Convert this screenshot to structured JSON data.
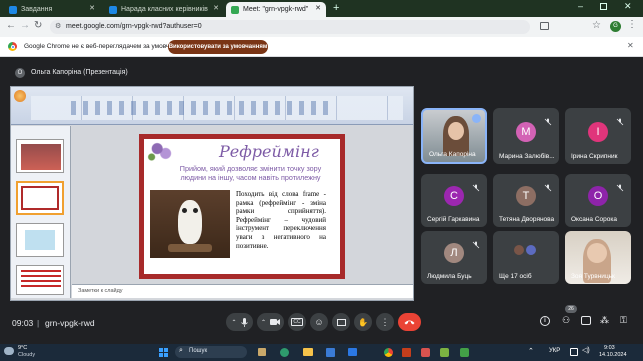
{
  "tabs": [
    {
      "label": "Завдання",
      "color": "#1e88e5"
    },
    {
      "label": "Нарада класних керівників",
      "color": "#1e88e5"
    },
    {
      "label": "Meet: \"grn-vpgk-rwd\"",
      "color": "#34a853"
    }
  ],
  "address": {
    "url": "meet.google.com/grn-vpgk-rwd?authuser=0"
  },
  "infobar": {
    "message": "Google Chrome не є веб-переглядачем за умовчанням",
    "button": "Використовувати за умовчанням"
  },
  "presentation": {
    "presenter_label": "Ольга Капоріна (Презентація)",
    "slide": {
      "title": "Рефреймінг",
      "subtitle": "Прийом, який дозволяє змінити точку зору людини на іншу, часом навіть протилежну",
      "body": "Походить від слова frame - рамка (рефреймінг - зміна рамки сприйняття). Рефреймінг – чудовий інструмент переключення уваги з негативного на позитивне."
    },
    "ppt_notes_hint": "Заметки к слайду"
  },
  "participants": [
    {
      "name": "Ольга Капоріна",
      "type": "video",
      "speaking": true
    },
    {
      "name": "Марина Залюбів...",
      "initial": "М",
      "color": "#d362b5"
    },
    {
      "name": "Ірина Скрипник",
      "initial": "І",
      "color": "#e0357b"
    },
    {
      "name": "Сергій Гаркавина",
      "initial": "С",
      "color": "#9c27b0"
    },
    {
      "name": "Тетяна Дворянова",
      "initial": "Т",
      "color": "#8d6e63"
    },
    {
      "name": "Оксана Сорока",
      "initial": "О",
      "color": "#8e24aa"
    },
    {
      "name": "Людмила Буць",
      "initial": "Л",
      "color": "#a1887f"
    },
    {
      "name": "Ще 17 осіб",
      "type": "more"
    },
    {
      "name": "Зоя Турвницьк",
      "type": "video"
    }
  ],
  "controls": {
    "time": "09:03",
    "meeting_code": "grn-vpgk-rwd",
    "people_count": "26"
  },
  "taskbar": {
    "weather_temp": "9°C",
    "weather_text": "Cloudy",
    "search_placeholder": "Пошук",
    "lang": "УКР",
    "clock_time": "9:03",
    "clock_date": "14.10.2024"
  }
}
